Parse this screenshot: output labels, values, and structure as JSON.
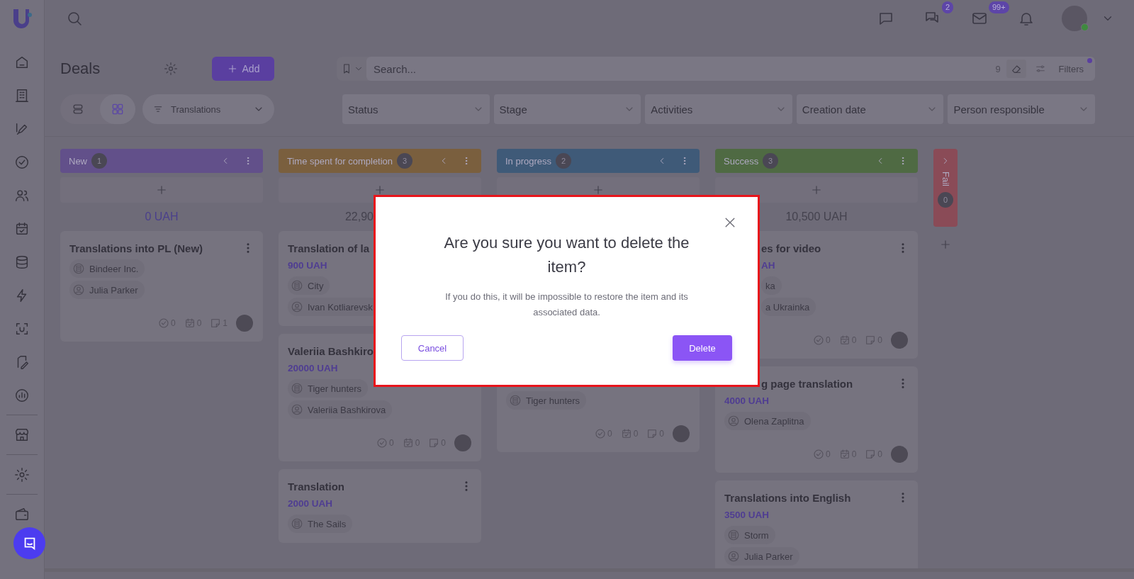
{
  "topbar": {
    "messages_badge": "2",
    "mail_badge": "99+",
    "user_online": true
  },
  "page_title": "Deals",
  "add_button": "Add",
  "view_toggle": [
    {
      "kind": "list",
      "selected": false
    },
    {
      "kind": "grid",
      "selected": true
    }
  ],
  "pipeline": "Translations",
  "search": {
    "placeholder": "Search...",
    "count": "9",
    "filters_label": "Filters",
    "filters_active": true
  },
  "filters": [
    "Status",
    "Stage",
    "Activities",
    "Creation date",
    "Person responsible"
  ],
  "columns": [
    {
      "title": "New",
      "count": "1",
      "color": "#62508a",
      "collapsed": false,
      "total": "0 UAH",
      "cards": [
        {
          "title": "Translations into PL (New)",
          "menu": true,
          "chips": [
            {
              "kind": "company",
              "text": "Bindeer Inc."
            },
            {
              "kind": "person",
              "text": "Julia Parker"
            }
          ],
          "footer": {
            "tasks": "0",
            "events": "0",
            "notes": "1"
          }
        }
      ]
    },
    {
      "title": "Time spent for completion",
      "count": "3",
      "color": "#7a5f3e",
      "collapsed": false,
      "total": "22,90",
      "total_covered": true,
      "cards": [
        {
          "title": "Translation of la",
          "price": "900 UAH",
          "menu": false,
          "chips": [
            {
              "kind": "company",
              "text": "City"
            },
            {
              "kind": "person",
              "text": "Ivan Kotliarevsk"
            }
          ]
        },
        {
          "title": "Valeriia Bashkiro",
          "price": "20000 UAH",
          "menu": false,
          "chips": [
            {
              "kind": "company",
              "text": "Tiger hunters"
            },
            {
              "kind": "person",
              "text": "Valeriia Bashkirova"
            }
          ],
          "footer": {
            "tasks": "0",
            "events": "0",
            "notes": "0"
          }
        },
        {
          "title": "Translation",
          "price": "2000 UAH",
          "menu": true,
          "chips": [
            {
              "kind": "company",
              "text": "The Sails"
            }
          ]
        }
      ]
    },
    {
      "title": "In progress",
      "count": "2",
      "color": "#3f5a78",
      "collapsed": false,
      "cards": [
        {
          "top_covered": true,
          "menu": false,
          "chips": [
            {
              "kind": "company",
              "text": "Tiger hunters"
            }
          ],
          "footer": {
            "tasks": "0",
            "events": "0",
            "notes": "0"
          }
        }
      ]
    },
    {
      "title": "Success",
      "count": "3",
      "color": "#4f6a43",
      "collapsed": false,
      "total": "10,500 UAH",
      "cards": [
        {
          "left_covered": true,
          "title": "es for video",
          "price": "AH",
          "menu": true,
          "chips": [
            {
              "kind": "company",
              "text": "ka"
            },
            {
              "kind": "person",
              "text": "a Ukrainka"
            }
          ],
          "footer": {
            "tasks": "0",
            "events": "0",
            "notes": "0"
          }
        },
        {
          "title_covered": true,
          "title": "g page translation",
          "price": "4000 UAH",
          "menu": true,
          "chips": [
            {
              "kind": "person",
              "text": "Olena Zaplitna"
            }
          ],
          "footer": {
            "tasks": "0",
            "events": "0",
            "notes": "0"
          }
        },
        {
          "title": "Translations into English",
          "price": "3500 UAH",
          "menu": true,
          "chips": [
            {
              "kind": "company",
              "text": "Storm"
            },
            {
              "kind": "person",
              "text": "Julia Parker"
            }
          ]
        }
      ]
    },
    {
      "title": "Fail",
      "count": "0",
      "color": "#8a4b57",
      "collapsed": true
    }
  ],
  "modal": {
    "title": "Are you sure you want to delete the item?",
    "message": "If you do this, it will be impossible to restore the item and its associated data.",
    "cancel": "Cancel",
    "confirm": "Delete"
  }
}
